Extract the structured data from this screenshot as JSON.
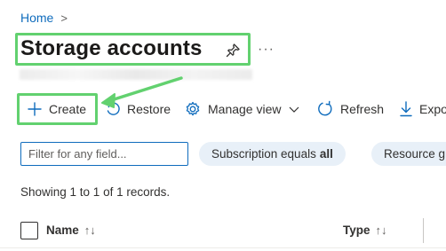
{
  "breadcrumb": {
    "home": "Home",
    "separator": ">"
  },
  "page": {
    "title": "Storage accounts",
    "more": "···"
  },
  "toolbar": {
    "create": "Create",
    "restore": "Restore",
    "manage_view": "Manage view",
    "refresh": "Refresh",
    "export": "Expo"
  },
  "filter": {
    "placeholder": "Filter for any field..."
  },
  "pills": {
    "subscription_prefix": "Subscription equals",
    "subscription_value": "all",
    "resource_group": "Resource g"
  },
  "records": "Showing 1 to 1 of 1 records.",
  "columns": {
    "name": "Name",
    "type": "Type",
    "sort": "↑↓"
  },
  "colors": {
    "highlight": "#62d16f",
    "accent": "#0f6cbd",
    "pill_bg": "#e8f0f8"
  },
  "icons": [
    "pin-icon",
    "plus-icon",
    "restore-icon",
    "gear-icon",
    "chevron-down-icon",
    "refresh-icon",
    "download-icon"
  ]
}
